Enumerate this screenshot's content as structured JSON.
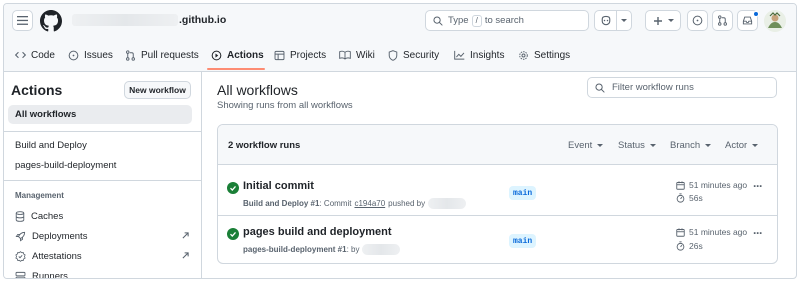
{
  "header": {
    "repo_path_suffix": ".github.io",
    "search_type_text": "Type",
    "search_key": "/",
    "search_suffix": "to search"
  },
  "tabs": [
    {
      "label": "Code",
      "icon": "code-icon"
    },
    {
      "label": "Issues",
      "icon": "issue-icon"
    },
    {
      "label": "Pull requests",
      "icon": "pull-request-icon"
    },
    {
      "label": "Actions",
      "icon": "play-icon",
      "active": true
    },
    {
      "label": "Projects",
      "icon": "table-icon"
    },
    {
      "label": "Wiki",
      "icon": "book-icon"
    },
    {
      "label": "Security",
      "icon": "shield-icon"
    },
    {
      "label": "Insights",
      "icon": "graph-icon"
    },
    {
      "label": "Settings",
      "icon": "gear-icon"
    }
  ],
  "sidebar": {
    "title": "Actions",
    "new_workflow": "New workflow",
    "all_workflows": "All workflows",
    "workflows": [
      "Build and Deploy",
      "pages-build-deployment"
    ],
    "management_heading": "Management",
    "management": [
      {
        "label": "Caches",
        "icon": "database-icon"
      },
      {
        "label": "Deployments",
        "icon": "rocket-icon",
        "external": true
      },
      {
        "label": "Attestations",
        "icon": "verified-icon",
        "external": true
      },
      {
        "label": "Runners",
        "icon": "server-icon"
      }
    ]
  },
  "main": {
    "title": "All workflows",
    "subtitle": "Showing runs from all workflows",
    "filter_placeholder": "Filter workflow runs",
    "runs_count": "2 workflow runs",
    "filters": [
      "Event",
      "Status",
      "Branch",
      "Actor"
    ],
    "runs": [
      {
        "title": "Initial commit",
        "workflow": "Build and Deploy #1",
        "meta_mid": ": Commit",
        "commit": "c194a70",
        "meta_end": "pushed by",
        "branch": "main",
        "time": "51 minutes ago",
        "duration": "56s"
      },
      {
        "title": "pages build and deployment",
        "workflow": "pages-build-deployment #1",
        "meta_mid": ": by",
        "branch": "main",
        "time": "51 minutes ago",
        "duration": "26s"
      }
    ]
  },
  "colors": {
    "success": "#1a7f37",
    "accent": "#0969da",
    "tab_underline": "#fd8c73"
  }
}
